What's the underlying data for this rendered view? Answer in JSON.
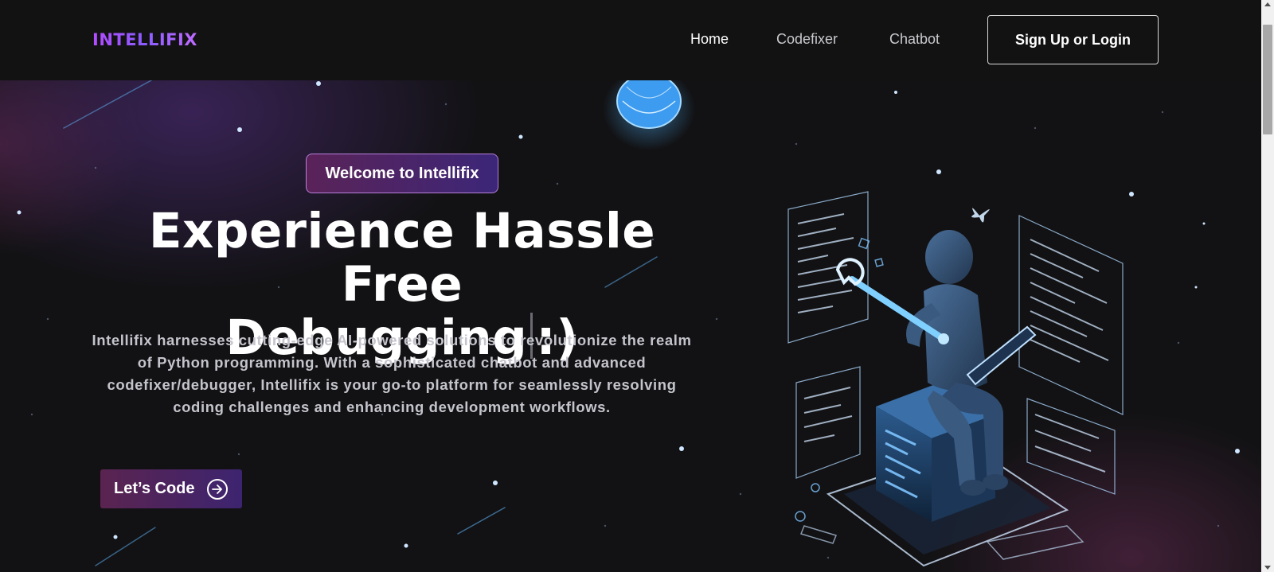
{
  "header": {
    "logo_text": "INTELLIFIX",
    "nav": {
      "home": "Home",
      "codefixer": "Codefixer",
      "chatbot": "Chatbot"
    },
    "signup_label": "Sign Up or Login"
  },
  "hero": {
    "badge": "Welcome to Intellifix",
    "headline_line1": "Experience Hassle Free",
    "headline_line2_a": "Debugging",
    "headline_line2_b": ":)",
    "description": "Intellifix harnesses cutting-edge AI-powered solutions to revolutionize the realm of Python programming. With a sophisticated chatbot and advanced codefixer/debugger, Intellifix is your go-to platform for seamlessly resolving coding challenges and enhancing development workflows.",
    "cta_label": "Let’s Code",
    "cta_icon": "arrow-right-circle-icon",
    "illustration": "robot-with-wrench-and-tablet-on-server-cube"
  },
  "colors": {
    "page_bg": "#121214",
    "logo_gradient_start": "#b44bff",
    "badge_gradient_start": "#5a2358",
    "badge_gradient_end": "#3c2678",
    "badge_border": "#b77fd8",
    "accent_blue": "#4fb4ff"
  }
}
